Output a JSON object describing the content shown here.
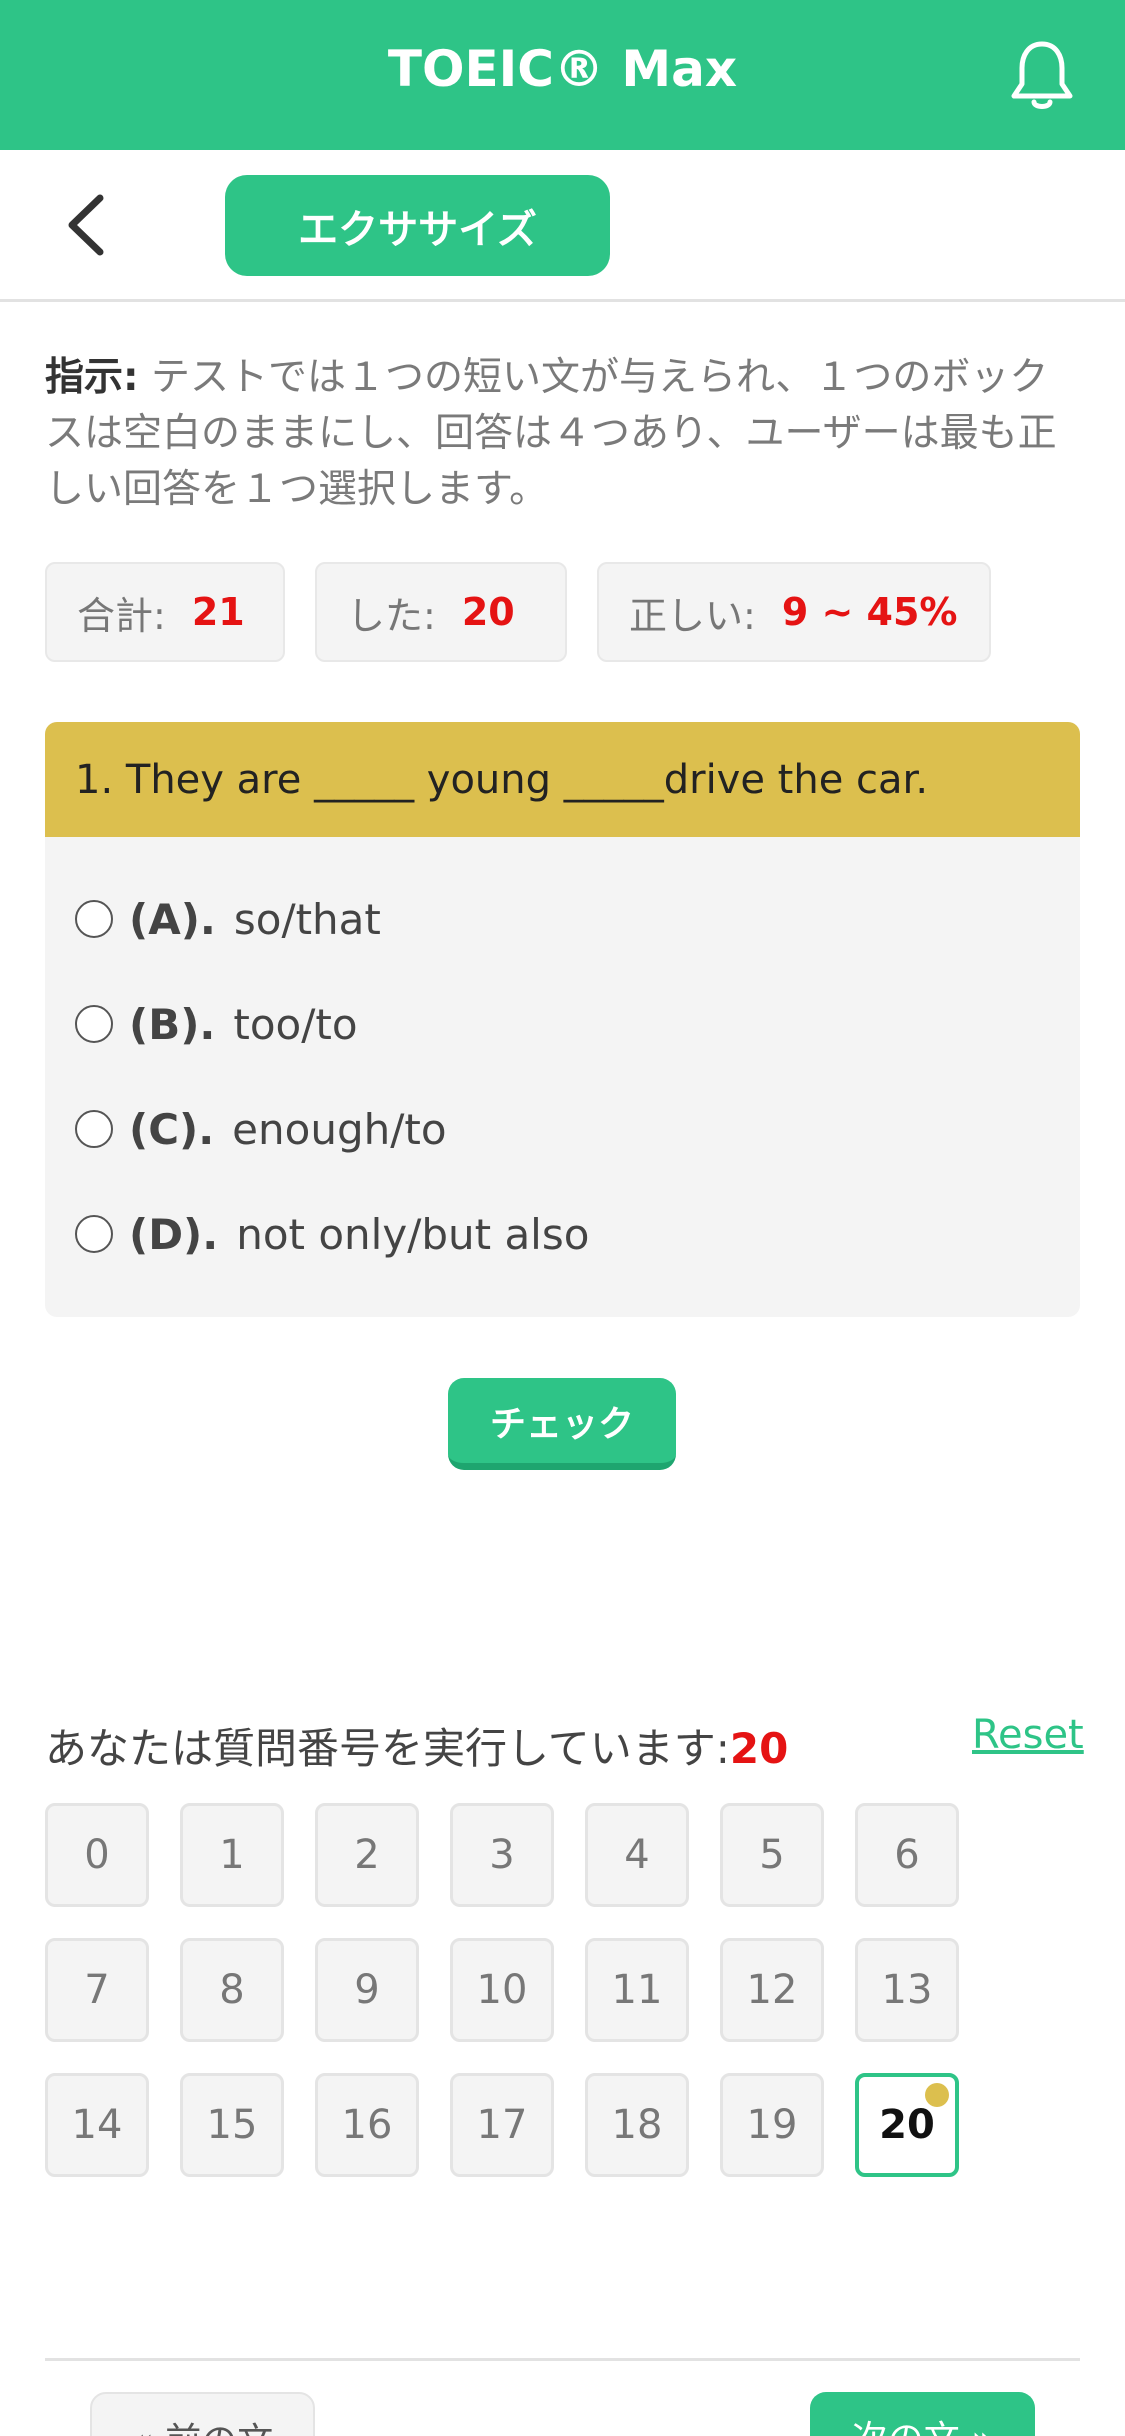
{
  "app": {
    "title": "TOEIC® Max"
  },
  "subheader": {
    "section_label": "エクササイズ"
  },
  "instructions": {
    "label": "指示:",
    "text": " テストでは１つの短い文が与えられ、１つのボックスは空白のままにし、回答は４つあり、ユーザーは最も正しい回答を１つ選択します。"
  },
  "stats": {
    "total_label": "合計:",
    "total_value": "21",
    "done_label": "した:",
    "done_value": "20",
    "correct_label": "正しい:",
    "correct_value": "9 ~ 45%"
  },
  "question": {
    "text": "1. They are _____ young _____drive the car.",
    "options": [
      {
        "key": "(A).",
        "text": "so/that"
      },
      {
        "key": "(B).",
        "text": "too/to"
      },
      {
        "key": "(C).",
        "text": "enough/to"
      },
      {
        "key": "(D).",
        "text": "not only/but also"
      }
    ]
  },
  "check_label": "チェック",
  "progress": {
    "label": "あなたは質問番号を実行しています:",
    "current": "20",
    "reset_label": "Reset"
  },
  "question_numbers": [
    "0",
    "1",
    "2",
    "3",
    "4",
    "5",
    "6",
    "7",
    "8",
    "9",
    "10",
    "11",
    "12",
    "13",
    "14",
    "15",
    "16",
    "17",
    "18",
    "19",
    "20"
  ],
  "active_question": "20",
  "nav": {
    "prev_label": "« 前の文",
    "next_label": "次の文 »"
  },
  "colors": {
    "primary": "#2ec487",
    "accent": "#dcbf4e",
    "highlight": "#e51313"
  },
  "icons": {
    "notification": "bell-icon",
    "back": "chevron-left-icon"
  }
}
